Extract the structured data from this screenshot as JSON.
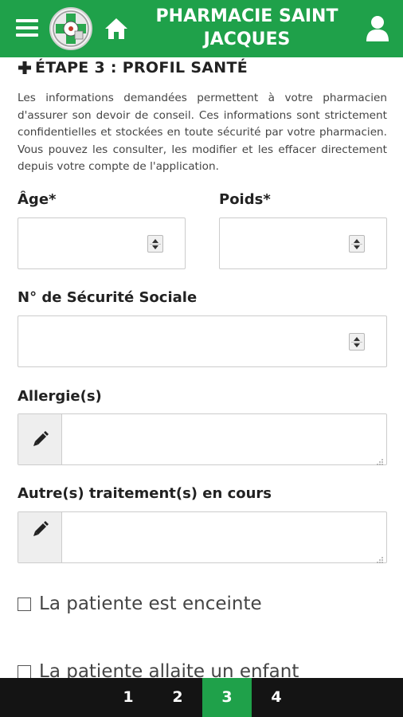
{
  "header": {
    "title": "PHARMACIE SAINT JACQUES",
    "brand_color": "#1fa14a",
    "icons": [
      "menu-icon",
      "logo",
      "home-icon",
      "user-icon"
    ]
  },
  "form": {
    "step_title": "ÉTAPE 3 : PROFIL SANTÉ",
    "intro": "Les informations demandées permettent à votre pharmacien d'assurer son devoir de conseil. Ces informations sont strictement confidentielles et stockées en toute sécurité par votre pharmacien. Vous pouvez les consulter, les modifier et les effacer directement depuis votre compte de l'application.",
    "age_label": "Âge*",
    "age_value": "",
    "weight_label": "Poids*",
    "weight_value": "",
    "ssn_label": "N° de Sécurité Sociale",
    "ssn_value": "",
    "allergies_label": "Allergie(s)",
    "allergies_value": "",
    "treatments_label": "Autre(s) traitement(s) en cours",
    "treatments_value": "",
    "pregnant_label": "La patiente est enceinte",
    "breastfeeding_label": "La patiente allaite un enfant"
  },
  "pager": {
    "pages": [
      "1",
      "2",
      "3",
      "4"
    ],
    "active": "3",
    "active_color": "#1fa14a",
    "bg_color": "#141414"
  }
}
